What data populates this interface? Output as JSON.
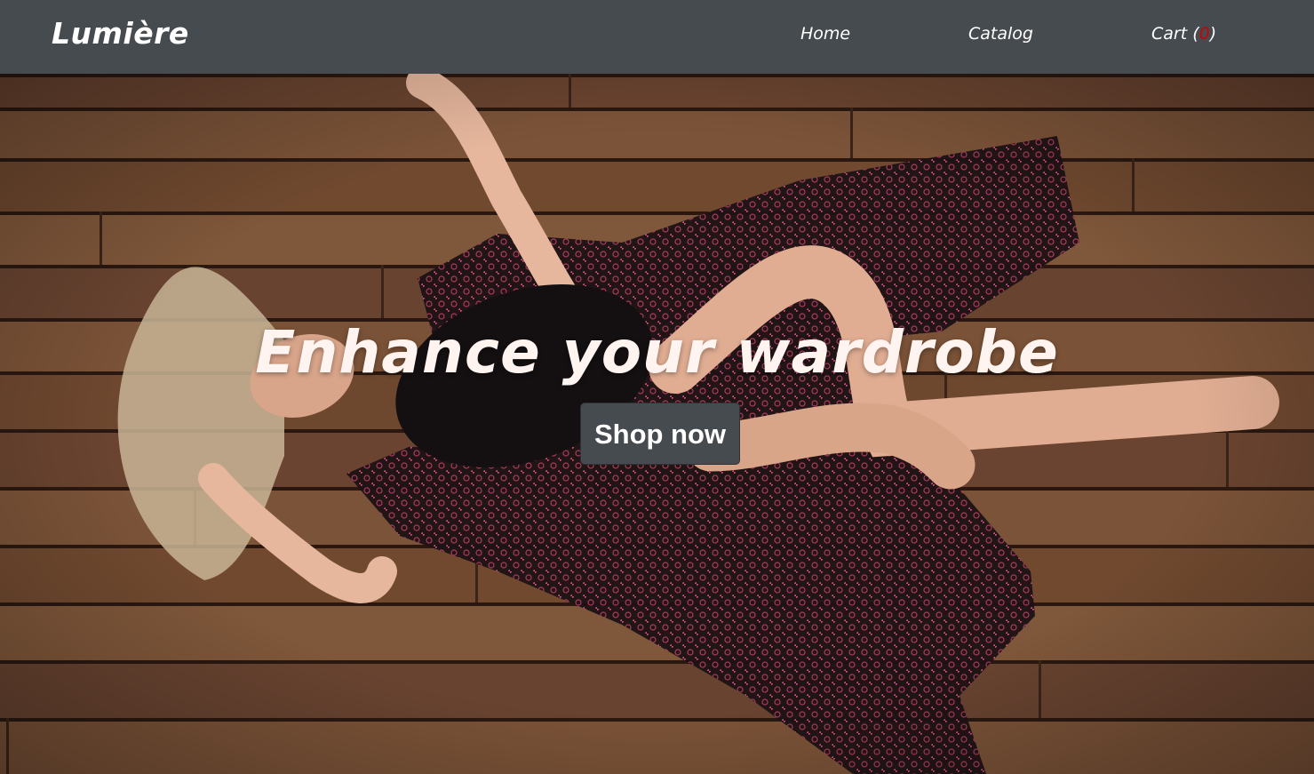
{
  "brand": {
    "name": "Lumière"
  },
  "nav": {
    "home_label": "Home",
    "catalog_label": "Catalog",
    "cart_prefix": "Cart (",
    "cart_count": "0",
    "cart_suffix": ")"
  },
  "hero": {
    "headline": "Enhance your wardrobe",
    "cta_label": "Shop now",
    "image_subject": "woman-lying-on-wooden-deck-photo"
  },
  "colors": {
    "navbar_bg": "#464b50",
    "nav_text": "#ffffff",
    "cart_count": "#d00000",
    "button_bg": "#464b50",
    "headline_text": "#fff4ef"
  }
}
